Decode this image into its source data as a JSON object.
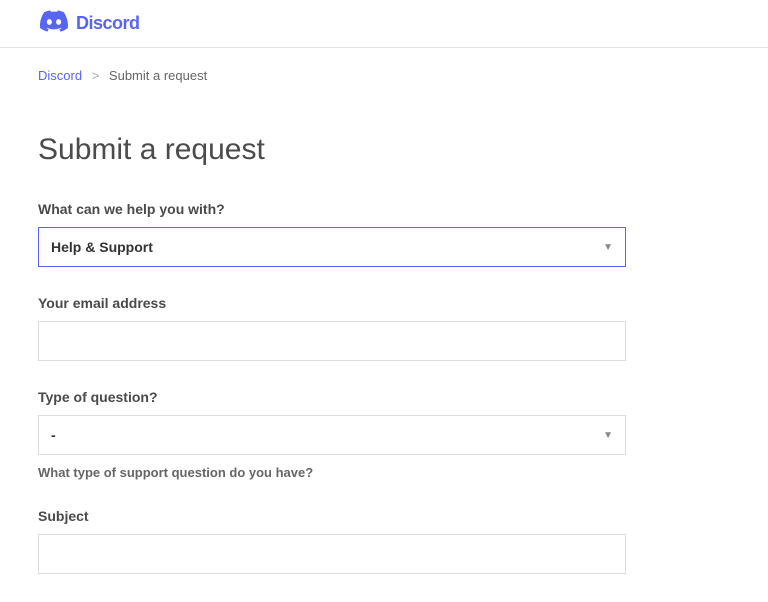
{
  "header": {
    "brand": "Discord"
  },
  "breadcrumb": {
    "root": "Discord",
    "current": "Submit a request"
  },
  "page": {
    "title": "Submit a request"
  },
  "form": {
    "help_with": {
      "label": "What can we help you with?",
      "value": "Help & Support"
    },
    "email": {
      "label": "Your email address",
      "value": ""
    },
    "question_type": {
      "label": "Type of question?",
      "value": "-",
      "hint": "What type of support question do you have?"
    },
    "subject": {
      "label": "Subject",
      "value": ""
    }
  }
}
